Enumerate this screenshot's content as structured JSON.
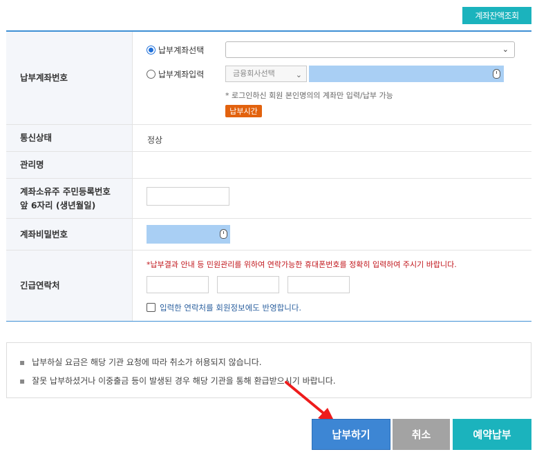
{
  "top_button": {
    "label": "계좌잔액조회"
  },
  "form": {
    "account": {
      "label": "납부계좌번호",
      "radio_select_label": "납부계좌선택",
      "radio_input_label": "납부계좌입력",
      "bank_select_placeholder": "금융회사선택",
      "note": "* 로그인하신 회원 본인명의의 계좌만 입력/납부 가능",
      "time_badge": "납부시간"
    },
    "status": {
      "label": "통신상태",
      "value": "정상"
    },
    "manager": {
      "label": "관리명",
      "value": ""
    },
    "owner_id": {
      "label": "계좌소유주 주민등록번호\n앞 6자리 (생년월일)"
    },
    "password": {
      "label": "계좌비밀번호"
    },
    "contact": {
      "label": "긴급연락처",
      "notice": "*납부결과 안내 등 민원관리를 위하여 연락가능한 휴대폰번호를 정확히 입력하여 주시기 바랍니다.",
      "checkbox_label": "입력한 연락처를 회원정보에도 반영합니다."
    }
  },
  "info": {
    "items": [
      "납부하실 요금은 해당 기관 요청에 따라 취소가 허용되지 않습니다.",
      "잘못 납부하셨거나 이중출금 등이 발생된 경우 해당 기관을 통해 환급받으시기 바랍니다."
    ]
  },
  "buttons": {
    "pay": "납부하기",
    "cancel": "취소",
    "reserve": "예약납부"
  },
  "colors": {
    "accent": "#1bb3bd",
    "primary_blue": "#3d86d4",
    "warning": "#c0141a",
    "badge": "#e2620e"
  }
}
